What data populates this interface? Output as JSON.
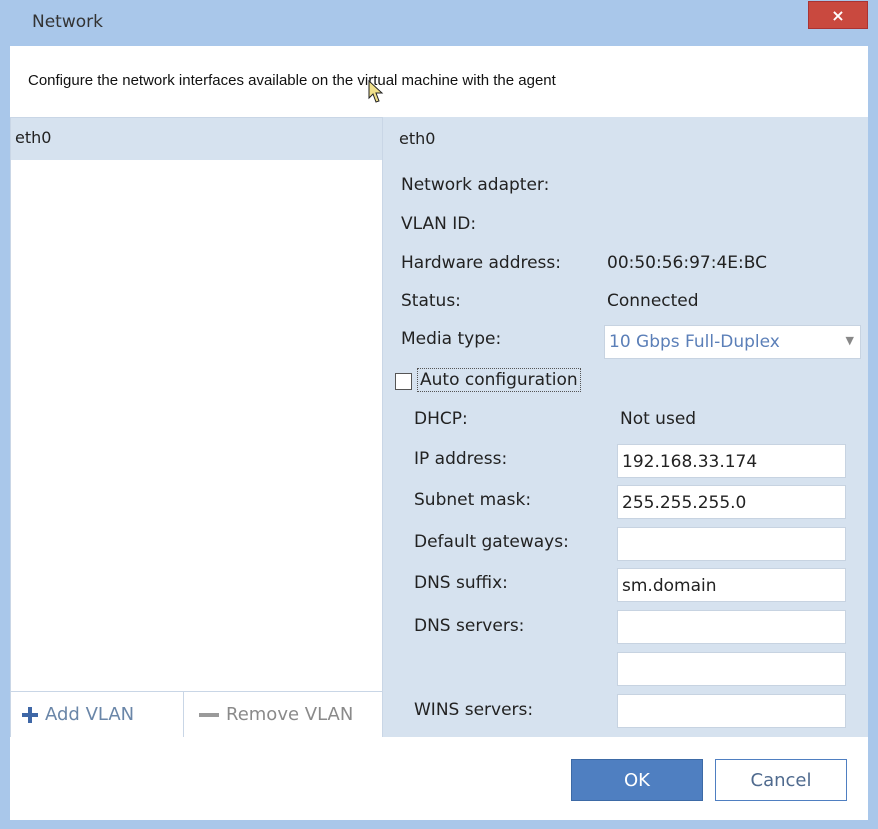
{
  "window": {
    "title": "Network",
    "close_glyph": "×"
  },
  "description": "Configure the network interfaces available on the virtual machine with the agent",
  "interfaces": {
    "items": [
      {
        "label": "eth0",
        "selected": true
      }
    ],
    "add_vlan_label": "Add VLAN",
    "remove_vlan_label": "Remove VLAN"
  },
  "details": {
    "title": "eth0",
    "network_adapter_label": "Network adapter:",
    "vlan_id_label": "VLAN ID:",
    "hardware_address_label": "Hardware address:",
    "hardware_address_value": "00:50:56:97:4E:BC",
    "status_label": "Status:",
    "status_value": "Connected",
    "media_type_label": "Media type:",
    "media_type_value": "10 Gbps Full-Duplex",
    "auto_configuration_label": "Auto configuration",
    "auto_configuration_checked": false,
    "dhcp_label": "DHCP:",
    "dhcp_value": "Not used",
    "ip_address_label": "IP address:",
    "ip_address_value": "192.168.33.174",
    "subnet_mask_label": "Subnet mask:",
    "subnet_mask_value": "255.255.255.0",
    "default_gateways_label": "Default gateways:",
    "default_gateways_value": "",
    "dns_suffix_label": "DNS suffix:",
    "dns_suffix_value": "sm.domain",
    "dns_servers_label": "DNS servers:",
    "dns_server_1_value": "",
    "dns_server_2_value": "",
    "wins_servers_label": "WINS servers:",
    "wins_servers_value": ""
  },
  "footer": {
    "ok_label": "OK",
    "cancel_label": "Cancel"
  },
  "colors": {
    "accent": "#4f7fc1",
    "titlebar": "#a9c7ea",
    "panel": "#d6e2ef",
    "close": "#c9493f"
  }
}
